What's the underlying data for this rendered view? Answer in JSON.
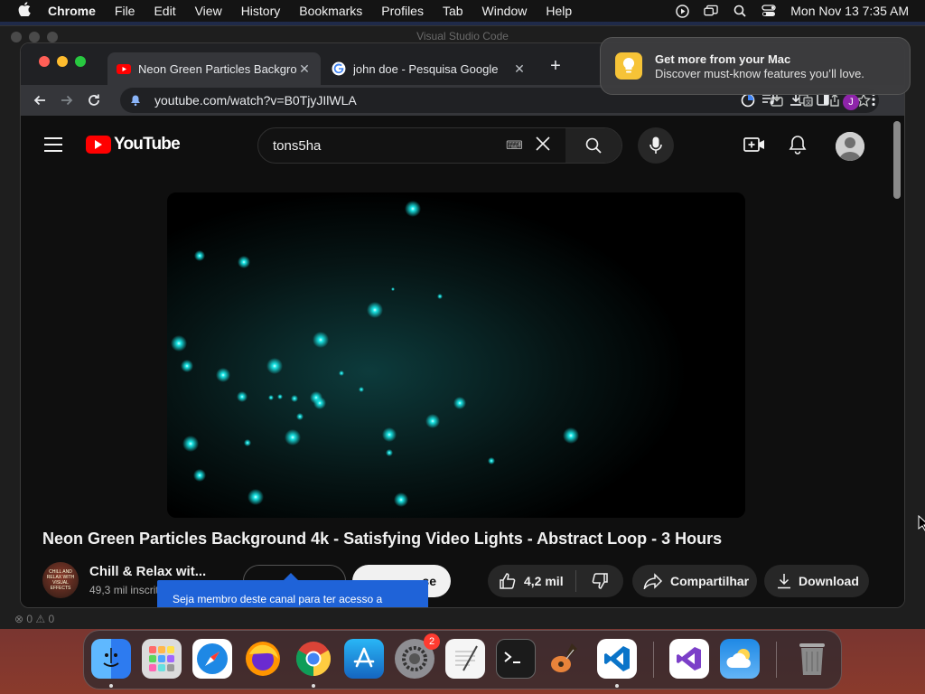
{
  "menubar": {
    "app": "Chrome",
    "items": [
      "File",
      "Edit",
      "View",
      "History",
      "Bookmarks",
      "Profiles",
      "Tab",
      "Window",
      "Help"
    ],
    "clock": "Mon Nov 13  7:35 AM"
  },
  "vscode": {
    "title": "Visual Studio Code",
    "status": "⊗ 0 ⚠ 0"
  },
  "chrome": {
    "tabs": [
      {
        "title": "Neon Green Particles Backgro",
        "active": true
      },
      {
        "title": "john doe - Pesquisa Google",
        "active": false
      }
    ],
    "url": "youtube.com/watch?v=B0TjyJIlWLA",
    "profile_initial": "J"
  },
  "youtube": {
    "logo": "YouTube",
    "search_value": "tons5ha",
    "video_title": "Neon Green Particles Background 4k - Satisfying Video Lights - Abstract Loop - 3 Hours",
    "channel_name": "Chill & Relax wit...",
    "subscribers": "49,3 mil inscrit",
    "subscribe_label": "se",
    "tooltip": "Seja membro deste canal para ter acesso a",
    "likes": "4,2 mil",
    "share_label": "Compartilhar",
    "download_label": "Download",
    "channel_avatar_text": "CHILL AND RELAX WITH VISUAL EFFECTS"
  },
  "notification": {
    "title": "Get more from your Mac",
    "body": "Discover must-know features you’ll love."
  },
  "dock": {
    "settings_badge": "2",
    "apps": [
      "finder-icon",
      "launchpad-icon",
      "safari-icon",
      "firefox-icon",
      "chrome-icon",
      "app-store-icon",
      "system-settings-icon",
      "textedit-icon",
      "terminal-icon",
      "garageband-icon",
      "vscode-icon",
      "visual-studio-icon",
      "weather-icon",
      "trash-icon"
    ]
  },
  "colors": {
    "yt_red": "#ff0000",
    "particle": "#19e6e6",
    "tooltip_blue": "#1f63d8"
  }
}
